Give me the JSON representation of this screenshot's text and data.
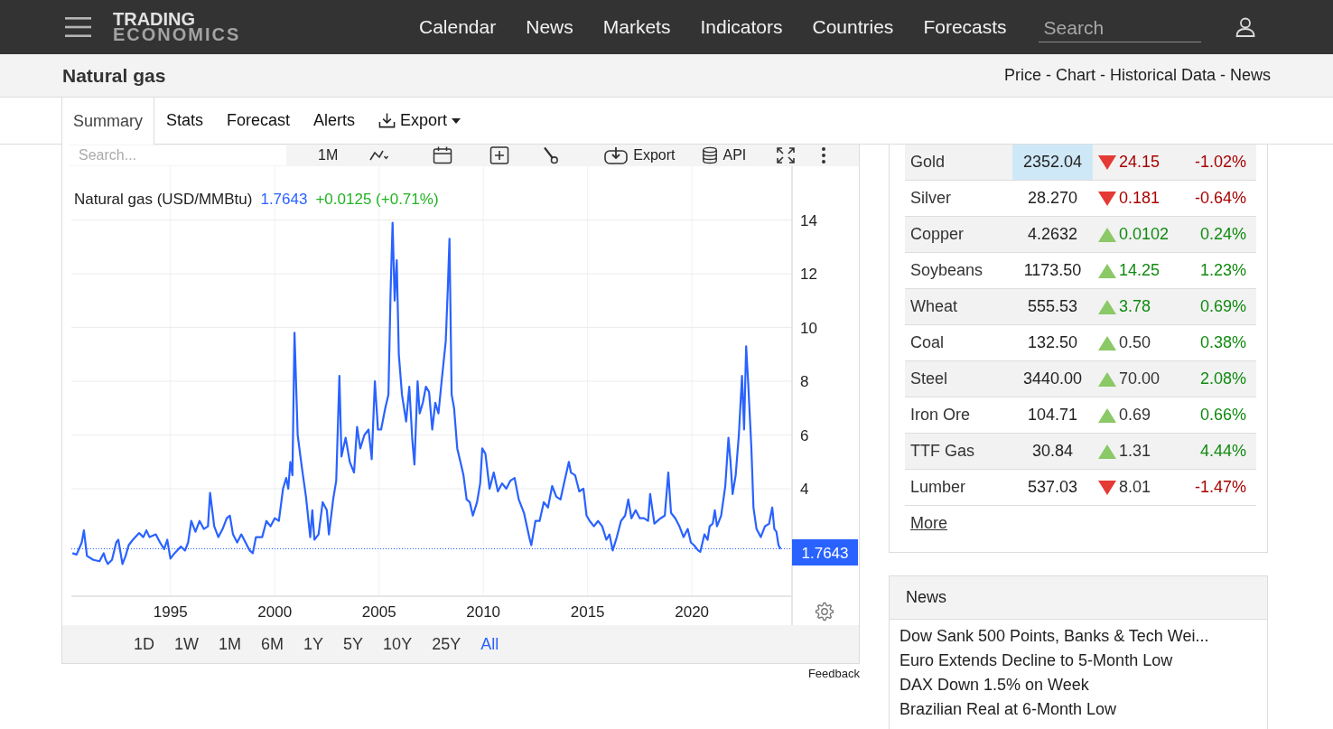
{
  "header": {
    "logo": [
      "TRADING",
      "ECONOMICS"
    ],
    "nav": [
      "Calendar",
      "News",
      "Markets",
      "Indicators",
      "Countries",
      "Forecasts"
    ],
    "search": {
      "placeholder": "Search"
    }
  },
  "title_bar": {
    "title": "Natural gas",
    "links": [
      "Price",
      "Chart",
      "Historical Data",
      "News"
    ],
    "separators": [
      "-",
      "-",
      "-"
    ]
  },
  "tabs": [
    {
      "label": "Summary",
      "kind": "plain",
      "selected": true
    },
    {
      "label": "Stats",
      "kind": "plain",
      "selected": false
    },
    {
      "label": "Forecast",
      "kind": "plain",
      "selected": false
    },
    {
      "label": "Alerts",
      "kind": "plain",
      "selected": false
    },
    {
      "label": "Export",
      "kind": "menu",
      "selected": false
    }
  ],
  "chart_toolbar": {
    "search": {
      "placeholder": "Search..."
    },
    "interval": "1M",
    "export": "Export",
    "api": "API"
  },
  "chart": {
    "legend": {
      "name": "Natural gas (USD/MMBtu)",
      "last": "1.7643",
      "change": "+0.0125 (+0.71%)"
    },
    "chart_data": {
      "type": "line",
      "x": [
        1990.3,
        1990.5,
        1990.75,
        1990.85,
        1991,
        1991.3,
        1991.6,
        1991.8,
        1991.9,
        1992,
        1992.2,
        1992.4,
        1992.5,
        1992.7,
        1992.85,
        1993,
        1993.2,
        1993.5,
        1993.7,
        1993.85,
        1994,
        1994.3,
        1994.5,
        1994.7,
        1994.85,
        1995,
        1995.2,
        1995.5,
        1995.7,
        1995.85,
        1996,
        1996.2,
        1996.4,
        1996.6,
        1996.8,
        1996.9,
        1997.1,
        1997.3,
        1997.5,
        1997.7,
        1997.85,
        1998,
        1998.2,
        1998.4,
        1998.6,
        1998.8,
        1998.95,
        1999.1,
        1999.4,
        1999.6,
        1999.8,
        2000,
        2000.2,
        2000.4,
        2000.55,
        2000.65,
        2000.75,
        2000.85,
        2000.95,
        2001.1,
        2001.3,
        2001.5,
        2001.7,
        2001.8,
        2001.9,
        2002.1,
        2002.3,
        2002.5,
        2002.6,
        2002.8,
        2002.95,
        2003.1,
        2003.2,
        2003.4,
        2003.6,
        2003.8,
        2003.95,
        2004.1,
        2004.3,
        2004.5,
        2004.65,
        2004.8,
        2004.95,
        2005.1,
        2005.3,
        2005.45,
        2005.55,
        2005.65,
        2005.75,
        2005.85,
        2005.95,
        2006.1,
        2006.3,
        2006.45,
        2006.6,
        2006.7,
        2006.85,
        2006.95,
        2007.1,
        2007.25,
        2007.4,
        2007.55,
        2007.7,
        2007.85,
        2008,
        2008.2,
        2008.3,
        2008.38,
        2008.48,
        2008.6,
        2008.75,
        2008.9,
        2009.05,
        2009.2,
        2009.35,
        2009.5,
        2009.7,
        2009.85,
        2009.95,
        2010.1,
        2010.3,
        2010.5,
        2010.7,
        2010.9,
        2011.1,
        2011.3,
        2011.5,
        2011.7,
        2011.95,
        2012.2,
        2012.3,
        2012.5,
        2012.7,
        2012.9,
        2013.1,
        2013.3,
        2013.5,
        2013.7,
        2013.9,
        2014.1,
        2014.2,
        2014.4,
        2014.6,
        2014.8,
        2014.95,
        2015.1,
        2015.3,
        2015.5,
        2015.7,
        2015.9,
        2016.05,
        2016.2,
        2016.4,
        2016.6,
        2016.8,
        2016.95,
        2017.1,
        2017.3,
        2017.5,
        2017.7,
        2017.9,
        2018,
        2018.2,
        2018.5,
        2018.7,
        2018.87,
        2019,
        2019.2,
        2019.4,
        2019.6,
        2019.8,
        2019.95,
        2020.1,
        2020.3,
        2020.4,
        2020.6,
        2020.75,
        2020.85,
        2021,
        2021.1,
        2021.2,
        2021.4,
        2021.6,
        2021.75,
        2021.85,
        2021.95,
        2022.1,
        2022.25,
        2022.4,
        2022.5,
        2022.6,
        2022.7,
        2022.85,
        2022.95,
        2023.1,
        2023.3,
        2023.5,
        2023.7,
        2023.85,
        2023.95,
        2024.05,
        2024.15,
        2024.25
      ],
      "series": [
        {
          "color": "#2962ff",
          "values": [
            1.6,
            1.55,
            2.0,
            2.45,
            1.5,
            1.35,
            1.3,
            1.6,
            1.35,
            1.2,
            1.35,
            2.0,
            2.1,
            1.2,
            1.5,
            1.9,
            2.1,
            2.35,
            2.2,
            2.45,
            2.2,
            2.3,
            2.0,
            1.75,
            2.1,
            1.4,
            1.6,
            1.85,
            1.7,
            2.0,
            2.8,
            2.4,
            2.8,
            2.5,
            2.6,
            3.85,
            2.6,
            2.2,
            2.5,
            2.9,
            3.0,
            2.3,
            2.0,
            2.3,
            2.0,
            1.7,
            1.6,
            2.2,
            2.2,
            2.8,
            2.6,
            2.9,
            2.8,
            4.0,
            4.4,
            4.0,
            5.0,
            4.5,
            9.8,
            6.0,
            4.8,
            3.7,
            2.2,
            3.2,
            2.1,
            2.3,
            3.5,
            3.2,
            2.3,
            3.6,
            4.3,
            8.2,
            5.2,
            5.9,
            5.0,
            4.6,
            6.3,
            5.5,
            6.0,
            6.2,
            5.1,
            8.0,
            6.2,
            6.2,
            7.0,
            7.5,
            11.2,
            13.9,
            11.0,
            12.5,
            9.0,
            7.5,
            6.5,
            7.8,
            5.8,
            4.9,
            8.0,
            6.8,
            7.2,
            7.8,
            7.6,
            6.2,
            7.2,
            6.8,
            8.0,
            9.5,
            11.5,
            13.3,
            7.5,
            7.0,
            5.5,
            5.0,
            4.5,
            3.6,
            3.5,
            3.0,
            3.5,
            4.2,
            5.5,
            5.3,
            4.0,
            4.6,
            3.9,
            4.2,
            4.0,
            4.3,
            4.4,
            3.6,
            3.1,
            2.2,
            1.9,
            2.8,
            2.8,
            3.5,
            3.3,
            4.1,
            3.7,
            3.6,
            4.3,
            5.0,
            4.6,
            4.5,
            3.9,
            4.0,
            3.0,
            2.8,
            2.6,
            2.8,
            2.6,
            2.1,
            2.3,
            1.7,
            2.2,
            2.8,
            3.0,
            3.6,
            2.9,
            3.2,
            2.9,
            2.9,
            2.8,
            3.8,
            2.7,
            2.9,
            3.0,
            4.6,
            3.1,
            2.9,
            2.6,
            2.2,
            2.5,
            2.0,
            1.9,
            1.7,
            1.65,
            2.3,
            2.1,
            2.6,
            2.7,
            3.2,
            2.6,
            3.0,
            4.1,
            5.9,
            5.0,
            3.8,
            4.5,
            6.0,
            8.2,
            6.2,
            9.3,
            7.9,
            5.5,
            3.3,
            2.5,
            2.2,
            2.6,
            2.7,
            3.3,
            2.5,
            2.4,
            1.9,
            1.76
          ]
        }
      ],
      "xlim": [
        1990.25,
        2024.8
      ],
      "ylim": [
        0,
        16
      ],
      "xticks": [
        1995,
        2000,
        2005,
        2010,
        2015,
        2020
      ],
      "yticks": [
        4,
        6,
        8,
        10,
        12,
        14
      ],
      "grid": true,
      "ref_lines": [
        {
          "axis": "y",
          "value": 1.7643,
          "label": "1.7643"
        }
      ]
    },
    "ranges": [
      {
        "label": "1D",
        "selected": false
      },
      {
        "label": "1W",
        "selected": false
      },
      {
        "label": "1M",
        "selected": false
      },
      {
        "label": "6M",
        "selected": false
      },
      {
        "label": "1Y",
        "selected": false
      },
      {
        "label": "5Y",
        "selected": false
      },
      {
        "label": "10Y",
        "selected": false
      },
      {
        "label": "25Y",
        "selected": false
      },
      {
        "label": "All",
        "selected": true
      }
    ],
    "feedback": "Feedback"
  },
  "markets": {
    "rows": [
      {
        "name": "Gold",
        "price": "2352.04",
        "kind": "down",
        "change": "24.15",
        "change_colored": true,
        "percent": "-1.02%",
        "highlighted": true
      },
      {
        "name": "Silver",
        "price": "28.270",
        "kind": "down",
        "change": "0.181",
        "change_colored": true,
        "percent": "-0.64%",
        "highlighted": false
      },
      {
        "name": "Copper",
        "price": "4.2632",
        "kind": "up",
        "change": "0.0102",
        "change_colored": true,
        "percent": "0.24%",
        "highlighted": false
      },
      {
        "name": "Soybeans",
        "price": "1173.50",
        "kind": "up",
        "change": "14.25",
        "change_colored": true,
        "percent": "1.23%",
        "highlighted": false
      },
      {
        "name": "Wheat",
        "price": "555.53",
        "kind": "up",
        "change": "3.78",
        "change_colored": true,
        "percent": "0.69%",
        "highlighted": false
      },
      {
        "name": "Coal",
        "price": "132.50",
        "kind": "up",
        "change": "0.50",
        "change_colored": false,
        "percent": "0.38%",
        "highlighted": false
      },
      {
        "name": "Steel",
        "price": "3440.00",
        "kind": "up",
        "change": "70.00",
        "change_colored": false,
        "percent": "2.08%",
        "highlighted": false
      },
      {
        "name": "Iron Ore",
        "price": "104.71",
        "kind": "up",
        "change": "0.69",
        "change_colored": false,
        "percent": "0.66%",
        "highlighted": false
      },
      {
        "name": "TTF Gas",
        "price": "30.84",
        "kind": "up",
        "change": "1.31",
        "change_colored": false,
        "percent": "4.44%",
        "highlighted": false
      },
      {
        "name": "Lumber",
        "price": "537.03",
        "kind": "down",
        "change": "8.01",
        "change_colored": false,
        "percent": "-1.47%",
        "highlighted": false
      }
    ],
    "more": "More"
  },
  "news": {
    "title": "News",
    "items": [
      "Dow Sank 500 Points, Banks & Tech Wei...",
      "Euro Extends Decline to 5-Month Low",
      "DAX Down 1.5% on Week",
      "Brazilian Real at 6-Month Low"
    ]
  }
}
